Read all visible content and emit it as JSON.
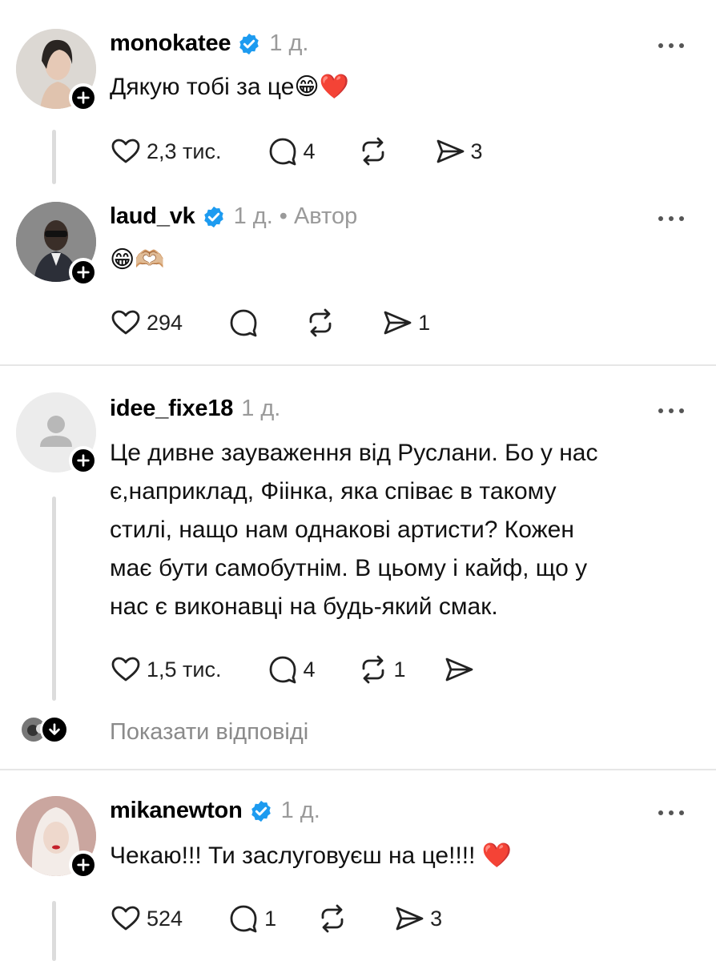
{
  "posts": [
    {
      "username": "monokatee",
      "verified": true,
      "time": "1 д.",
      "text": "Дякую тобі за це😁❤️",
      "likes": "2,3 тис.",
      "replies": "4",
      "reposts": "",
      "shares": "3"
    },
    {
      "username": "laud_vk",
      "verified": true,
      "time": "1 д.",
      "dot": "•",
      "author_badge": "Автор",
      "text": "😁🫶🏼",
      "likes": "294",
      "replies": "",
      "reposts": "",
      "shares": "1"
    },
    {
      "username": "idee_fixe18",
      "verified": false,
      "time": "1 д.",
      "text_lines": [
        "Це дивне зауваження від Руслани. Бо у нас",
        "є,наприклад, Фіінка, яка співає в такому",
        "стилі, нащо нам однакові артисти? Кожен",
        "має бути самобутнім. В цьому і кайф, що у",
        "нас є виконавці на будь-який смак."
      ],
      "likes": "1,5 тис.",
      "replies": "4",
      "reposts": "1",
      "shares": ""
    },
    {
      "username": "mikanewton",
      "verified": true,
      "time": "1 д.",
      "text": "Чекаю!!! Ти заслуговуєш на це!!!! ❤️",
      "likes": "524",
      "replies": "1",
      "reposts": "",
      "shares": "3"
    }
  ],
  "show_replies_label": "Показати відповіді",
  "icons": {
    "like": "heart-icon",
    "reply": "comment-icon",
    "repost": "repost-icon",
    "share": "send-icon",
    "verified": "verified-badge-icon",
    "follow": "plus-icon",
    "more": "more-icon"
  },
  "colors": {
    "verified": "#1d9bf0",
    "muted": "#9a9a9a",
    "text": "#111111"
  }
}
